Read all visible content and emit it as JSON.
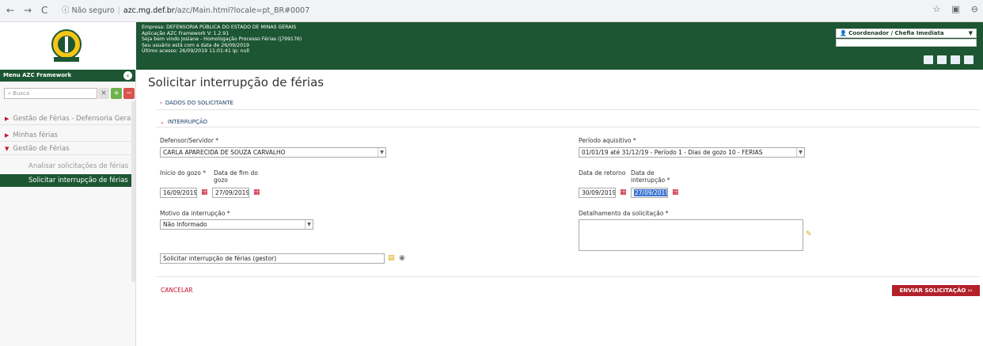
{
  "browser": {
    "back": "←",
    "forward": "→",
    "reload": "C",
    "security_label": "Não seguro",
    "url_host": "azc.mg.def.br",
    "url_path": "/azc/Main.html?locale=pt_BR#0007"
  },
  "header": {
    "info_lines": [
      "Empresa: DEFENSORIA PÚBLICA DO ESTADO DE MINAS GERAIS",
      "Aplicação AZC Framework V: 1.2.91",
      "Seja bem vindo Josiane - Homologação Processo Férias (j799176)",
      "Seu usuário está com a data de 26/09/2019",
      "Último acesso: 26/09/2019 11:01:41 Ip: null"
    ],
    "role": "Coordenador / Chefia Imediata"
  },
  "sidebar": {
    "title": "Menu AZC Framework",
    "search_placeholder": "Busca",
    "items": [
      {
        "label": "Gestão de Férias - Defensoria Geral"
      },
      {
        "label": "Minhas férias"
      },
      {
        "label": "Gestão de Férias"
      }
    ],
    "sub_items": [
      {
        "label": "Analisar solicitações de férias"
      },
      {
        "label": "Solicitar interrupção de férias"
      }
    ]
  },
  "main": {
    "title": "Solicitar interrupção de férias",
    "section1": "DADOS DO SOLICITANTE",
    "section2": "INTERRUPÇÃO",
    "defensor_label": "Defensor/Servidor *",
    "defensor_value": "CARLA APARECIDA DE SOUZA CARVALHO",
    "periodo_label": "Período aquisitivo *",
    "periodo_value": "01/01/19 até 31/12/19 - Período 1 - Dias de gozo 10 - FERIAS",
    "inicio_label": "Início do gozo *",
    "inicio_value": "16/09/2019",
    "fim_label": "Data de fim do gozo",
    "fim_value": "27/09/2019",
    "retorno_label": "Data de retorno",
    "retorno_value": "30/09/2019",
    "interrupcao_label": "Data de interrupção *",
    "interrupcao_value": "27/09/2019",
    "motivo_label": "Motivo da interrupção *",
    "motivo_value": "Não Informado",
    "detalhamento_label": "Detalhamento da solicitação *",
    "workflow_value": "Solicitar interrupção de férias (gestor)",
    "cancel": "CANCELAR",
    "send": "ENVIAR SOLICITAÇÃO  ››"
  }
}
